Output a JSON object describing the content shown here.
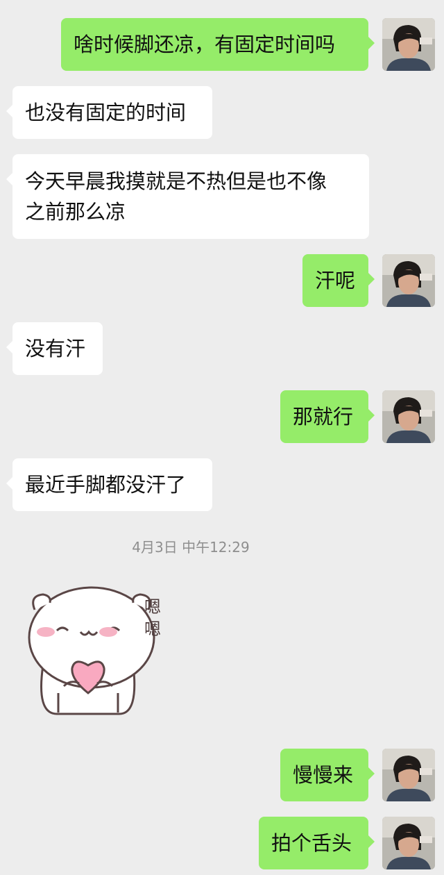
{
  "messages": [
    {
      "id": 1,
      "side": "out",
      "text": "啥时候脚还凉，有固定时间吗"
    },
    {
      "id": 2,
      "side": "in",
      "text": "也没有固定的时间"
    },
    {
      "id": 3,
      "side": "in",
      "text": "今天早晨我摸就是不热但是也不像\n之前那么凉"
    },
    {
      "id": 4,
      "side": "out",
      "text": "汗呢"
    },
    {
      "id": 5,
      "side": "in",
      "text": "没有汗"
    },
    {
      "id": 6,
      "side": "out",
      "text": "那就行"
    },
    {
      "id": 7,
      "side": "in",
      "text": "最近手脚都没汗了"
    },
    {
      "id": 8,
      "side": "out",
      "text": "慢慢来"
    },
    {
      "id": 9,
      "side": "out",
      "text": "拍个舌头"
    }
  ],
  "timestamp": "4月3日 中午12:29",
  "sticker": {
    "name": "bear-sticker",
    "text_line1": "嗯",
    "text_line2": "嗯"
  },
  "colors": {
    "background": "#ededed",
    "outgoing_bubble": "#95ec69",
    "incoming_bubble": "#ffffff",
    "timestamp_text": "#8e8e8e"
  }
}
